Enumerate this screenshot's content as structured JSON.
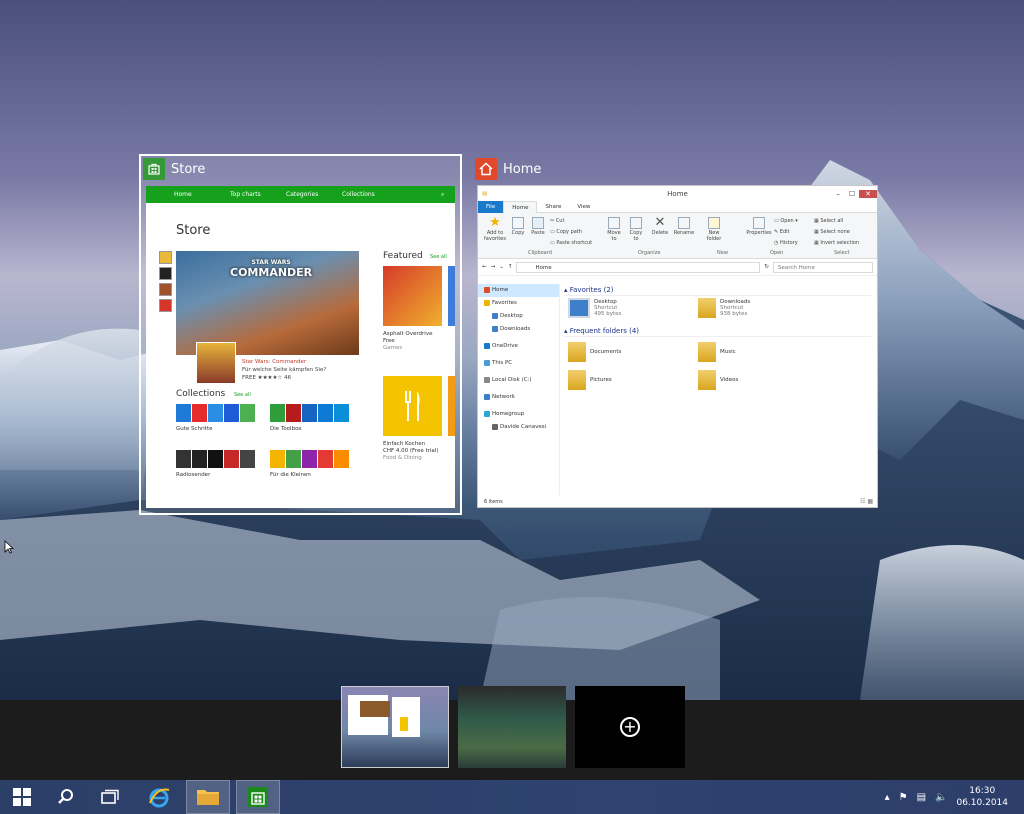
{
  "windows": {
    "store": {
      "title": "Store",
      "nav": [
        "Home",
        "Top charts",
        "Categories",
        "Collections"
      ],
      "page_title": "Store",
      "hero": {
        "logo_top": "STAR WARS",
        "logo_main": "COMMANDER",
        "name": "Star Wars: Commander",
        "desc": "Für welche Seite kämpfen Sie?",
        "price": "FREE",
        "rating_count": "46"
      },
      "featured_title": "Featured",
      "see_all": "See all",
      "featured": [
        {
          "name": "Asphalt Overdrive",
          "price": "Free",
          "cat": "Games"
        },
        {
          "name": "Einfach Kochen",
          "price": "CHF 4.00",
          "trial": "Free trial",
          "cat": "Food & Dining"
        }
      ],
      "collections_title": "Collections",
      "collections_see_all": "See all",
      "collections": [
        "Gute Schritte",
        "Die Toolbox",
        "Radiosender",
        "Für die Kleinen"
      ]
    },
    "explorer": {
      "title": "Home",
      "window_title": "Home",
      "tabs": [
        "File",
        "Home",
        "Share",
        "View"
      ],
      "ribbon": {
        "clipboard": {
          "label": "Clipboard",
          "add_fav": "Add to favorites",
          "copy": "Copy",
          "paste": "Paste",
          "cut": "Cut",
          "copy_path": "Copy path",
          "paste_shortcut": "Paste shortcut"
        },
        "organize": {
          "label": "Organize",
          "move": "Move to",
          "copy": "Copy to",
          "delete": "Delete",
          "rename": "Rename"
        },
        "new": {
          "label": "New",
          "new_folder": "New folder"
        },
        "open": {
          "label": "Open",
          "properties": "Properties",
          "open": "Open",
          "edit": "Edit",
          "history": "History"
        },
        "select": {
          "label": "Select",
          "select_all": "Select all",
          "select_none": "Select none",
          "invert": "Invert selection"
        }
      },
      "address": "Home",
      "search_placeholder": "Search Home",
      "nav": [
        "Home",
        "Favorites",
        "Desktop",
        "Downloads",
        "OneDrive",
        "This PC",
        "Local Disk (C:)",
        "Network",
        "Homegroup",
        "Davide Canavesi"
      ],
      "favorites_header": "Favorites (2)",
      "frequent_header": "Frequent folders (4)",
      "favorites": [
        {
          "name": "Desktop",
          "type": "Shortcut",
          "size": "495 bytes"
        },
        {
          "name": "Downloads",
          "type": "Shortcut",
          "size": "938 bytes"
        }
      ],
      "folders": [
        "Documents",
        "Music",
        "Pictures",
        "Videos"
      ],
      "status": "6 items"
    }
  },
  "taskview": {
    "add_desktop": "+"
  },
  "clock": {
    "time": "16:30",
    "date": "06.10.2014"
  },
  "colors": {
    "store_green": "#15a11b",
    "home_orange": "#e04a2b",
    "file_blue": "#1979ca"
  }
}
